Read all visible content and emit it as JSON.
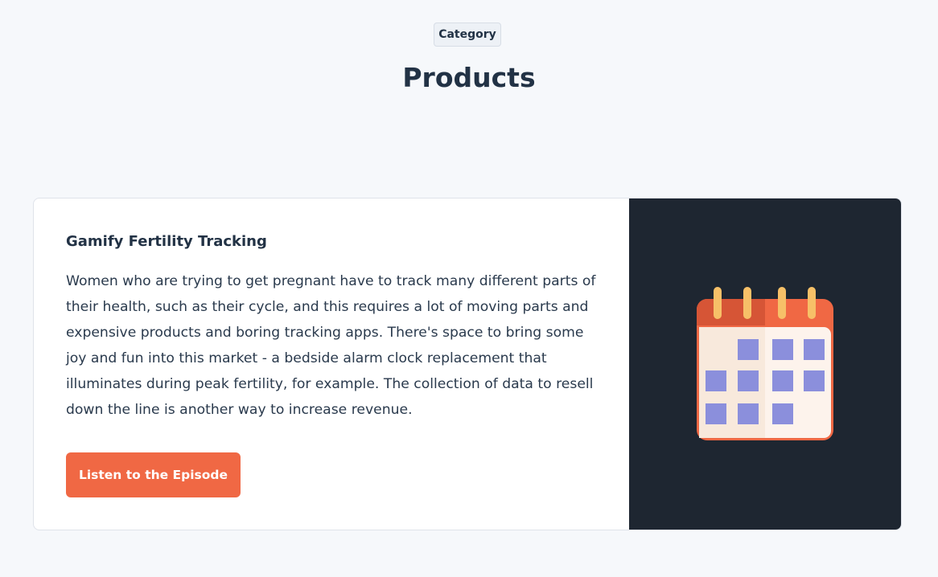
{
  "header": {
    "category_label": "Category",
    "title": "Products"
  },
  "card": {
    "title": "Gamify Fertility Tracking",
    "description": "Women who are trying to get pregnant have to track many different parts of their health, such as their cycle, and this requires a lot of moving parts and expensive products and boring tracking apps. There's space to bring some joy and fun into this market - a bedside alarm clock replacement that illuminates during peak fertility, for example. The collection of data to resell down the line is another way to increase revenue.",
    "button_label": "Listen to the Episode",
    "illustration_icon": "calendar-icon"
  },
  "colors": {
    "accent": "#f06844",
    "media_background": "#1e2631",
    "page_background": "#f6f8fb",
    "text": "#223245",
    "calendar_square": "#8b8fdc"
  }
}
